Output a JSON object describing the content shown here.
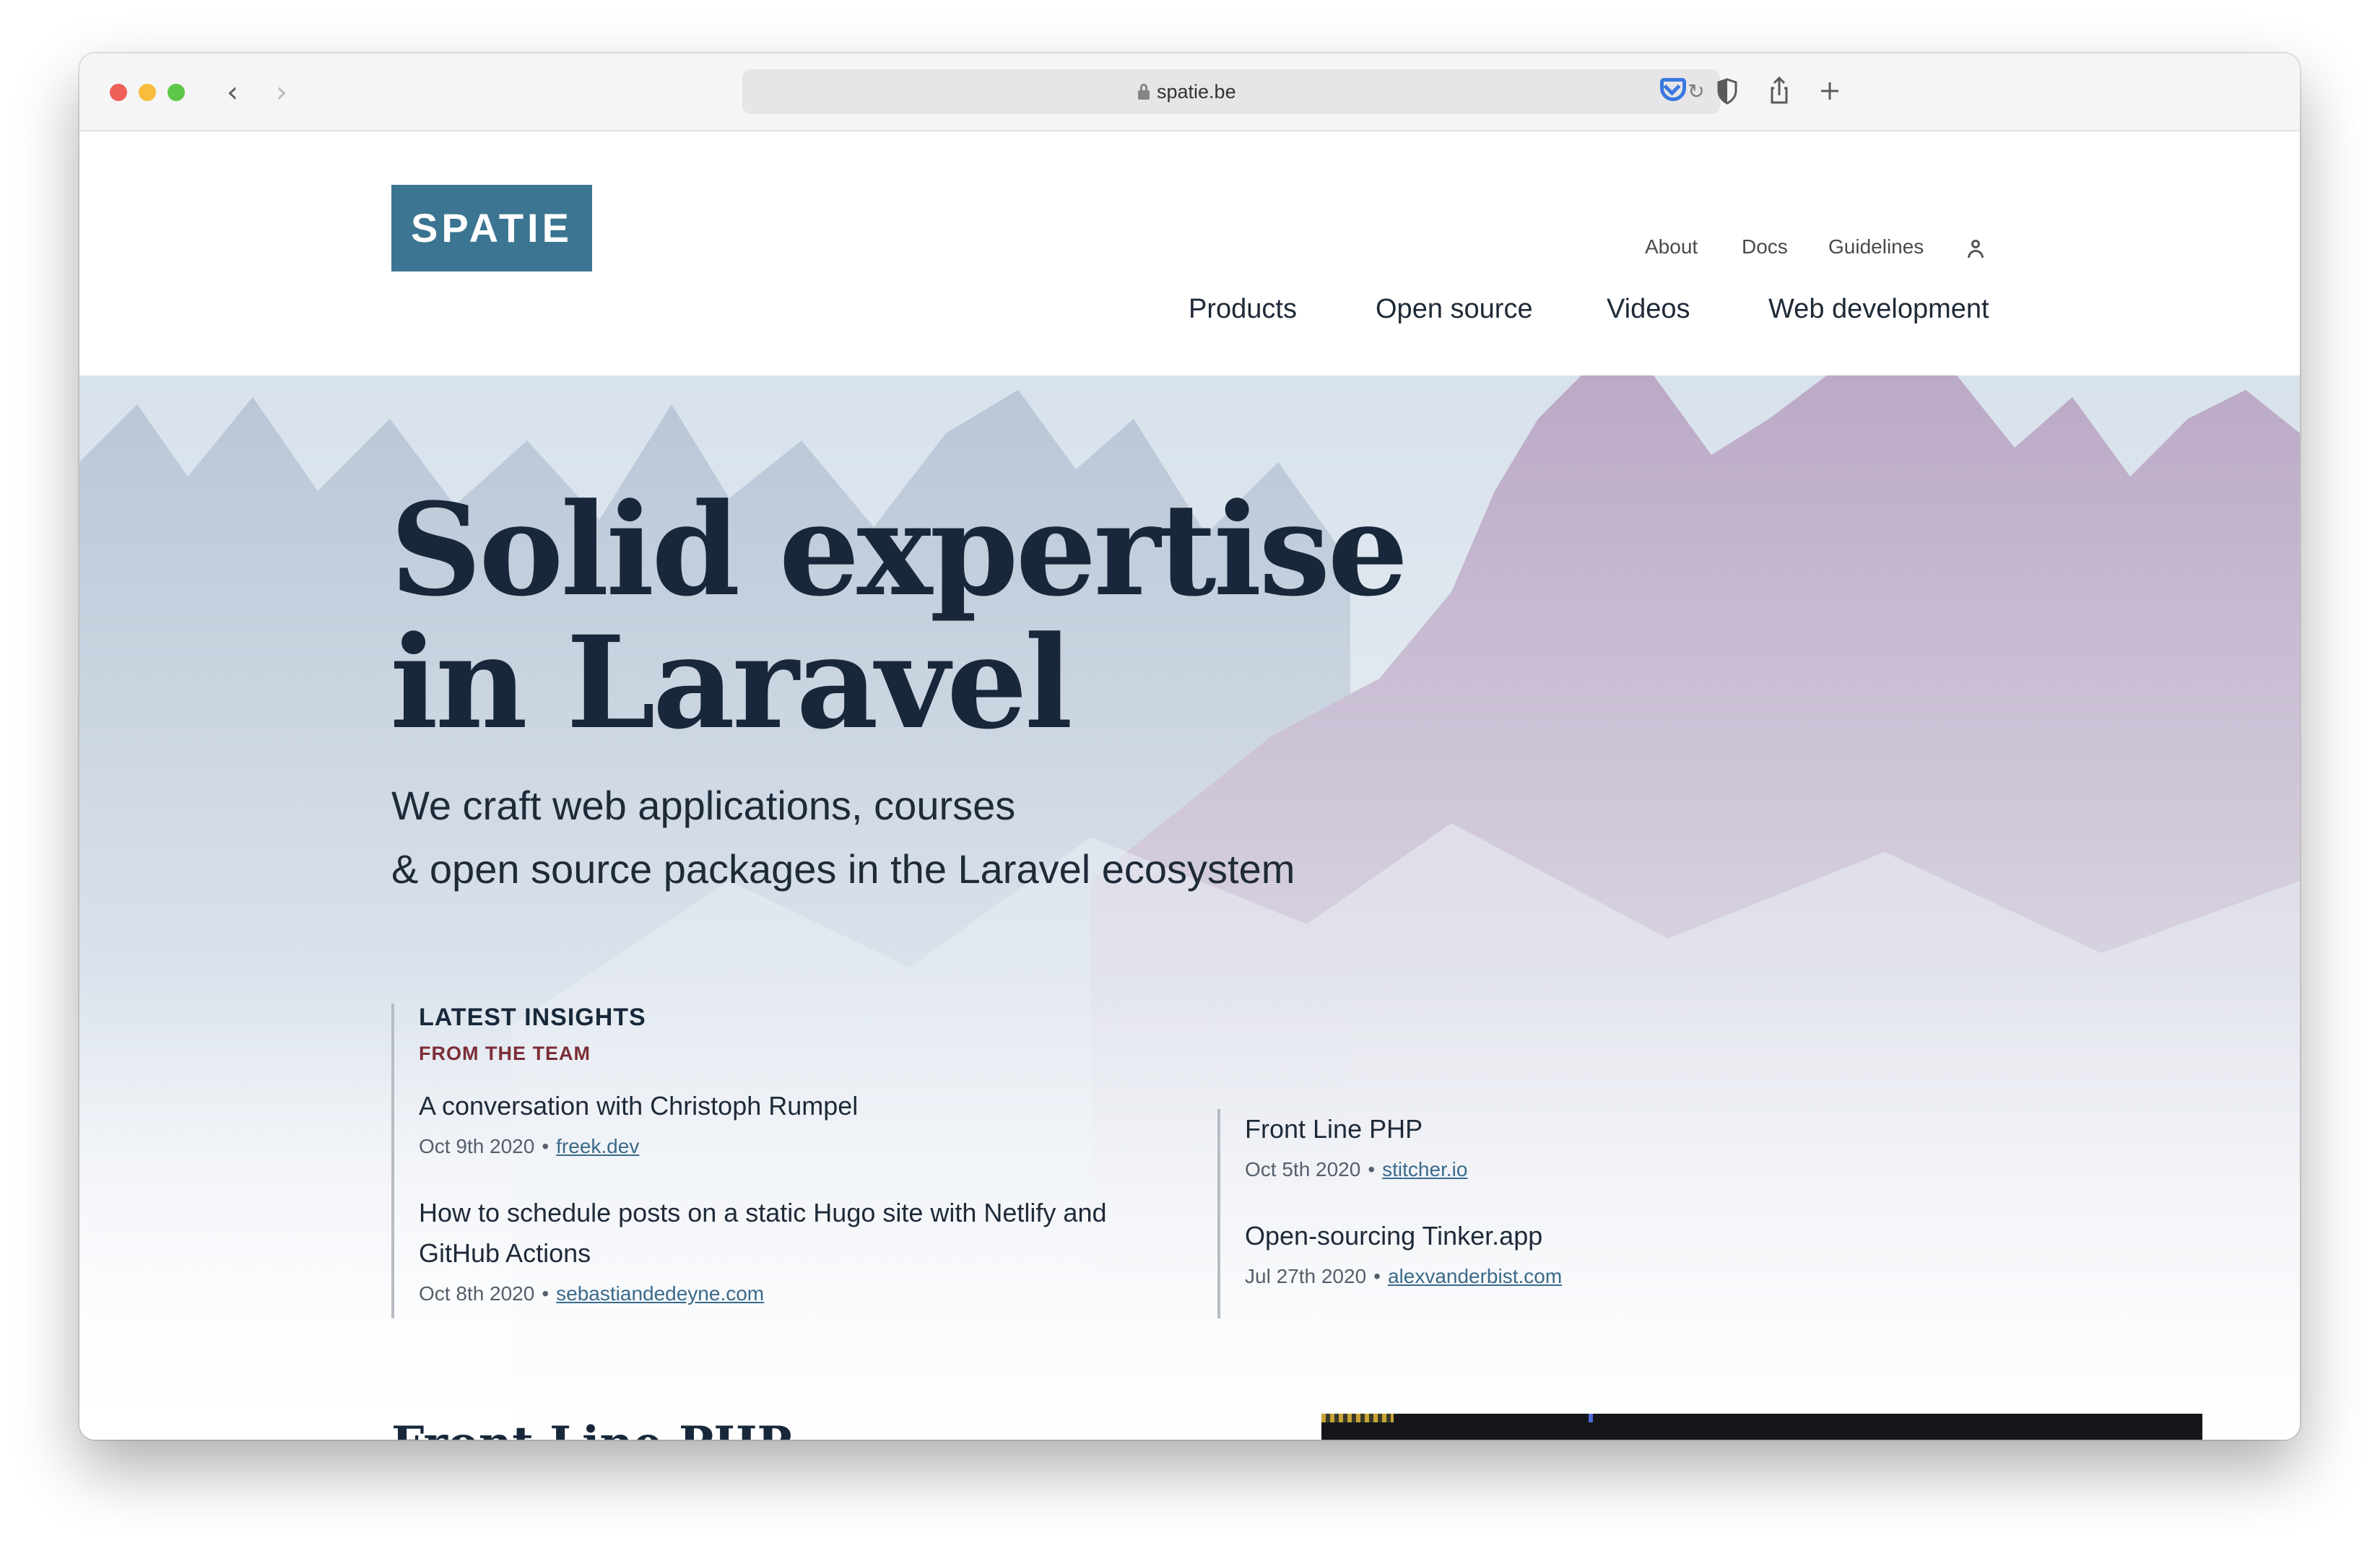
{
  "browser": {
    "url": "spatie.be"
  },
  "site": {
    "logo": "SPATIE",
    "secondary_nav": [
      "About",
      "Docs",
      "Guidelines"
    ],
    "main_nav": [
      "Products",
      "Open source",
      "Videos",
      "Web development"
    ]
  },
  "hero": {
    "title_lines": [
      "Solid expertise",
      "in Laravel"
    ],
    "subtitle_lines": [
      "We craft web applications, courses",
      "& open source packages in the Laravel ecosystem"
    ]
  },
  "insights": {
    "heading": "LATEST INSIGHTS",
    "subheading": "FROM THE TEAM",
    "left_posts": [
      {
        "title": "A conversation with Christoph Rumpel",
        "date": "Oct 9th 2020",
        "source": "freek.dev"
      },
      {
        "title": "How to schedule posts on a static Hugo site with Netlify and GitHub Actions",
        "date": "Oct 8th 2020",
        "source": "sebastiandedeyne.com"
      }
    ],
    "right_posts": [
      {
        "title": "Front Line PHP",
        "date": "Oct 5th 2020",
        "source": "stitcher.io"
      },
      {
        "title": "Open-sourcing Tinker.app",
        "date": "Jul 27th 2020",
        "source": "alexvanderbist.com"
      }
    ]
  },
  "next_section": {
    "heading": "Front Line PHP"
  },
  "colors": {
    "brand": "#3b7592",
    "heading": "#18283a",
    "accent_red": "#7b2d35",
    "link": "#3b6a8a"
  },
  "icons": [
    "back-icon",
    "forward-icon",
    "lock-icon",
    "reload-icon",
    "pocket-icon",
    "shield-icon",
    "share-icon",
    "plus-icon",
    "user-icon"
  ]
}
